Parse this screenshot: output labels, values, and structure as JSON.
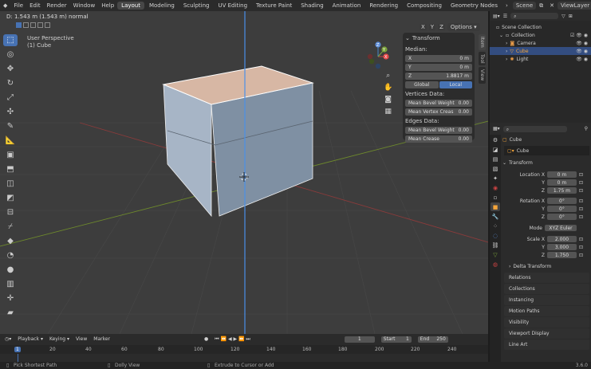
{
  "menu": {
    "items": [
      "File",
      "Edit",
      "Render",
      "Window",
      "Help"
    ]
  },
  "workspaces": [
    "Layout",
    "Modeling",
    "Sculpting",
    "UV Editing",
    "Texture Paint",
    "Shading",
    "Animation",
    "Rendering",
    "Compositing",
    "Geometry Nodes"
  ],
  "scene": "Scene",
  "view_layer": "ViewLayer",
  "viewport": {
    "op_status": "D: 1.543 m (1.543 m) normal",
    "view_name": "User Perspective",
    "object_name": "(1) Cube",
    "options_label": "Options",
    "axis_x": "X",
    "axis_y": "Y",
    "axis_z": "Z"
  },
  "npanel": {
    "title": "Transform",
    "median_label": "Median:",
    "x_label": "X",
    "x_val": "0 m",
    "y_label": "Y",
    "y_val": "0 m",
    "z_label": "Z",
    "z_val": "1.8817 m",
    "global": "Global",
    "local": "Local",
    "vertices_data": "Vertices Data:",
    "mean_bevel_weight": "Mean Bevel Weight",
    "mean_bevel_weight_val": "0.00",
    "mean_vertex_crease": "Mean Vertex Creas",
    "mean_vertex_crease_val": "0.00",
    "edges_data": "Edges Data:",
    "edge_bevel_weight": "Mean Bevel Weight",
    "edge_bevel_weight_val": "0.00",
    "mean_crease": "Mean Crease",
    "mean_crease_val": "0.00",
    "tabs": [
      "Item",
      "Tool",
      "View"
    ]
  },
  "outliner": {
    "rows": [
      {
        "name": "Scene Collection"
      },
      {
        "name": "Collection"
      },
      {
        "name": "Camera"
      },
      {
        "name": "Cube"
      },
      {
        "name": "Light"
      }
    ]
  },
  "properties": {
    "object_name": "Cube",
    "data_name": "Cube",
    "transform_title": "Transform",
    "location": {
      "label": "Location X",
      "x": "0 m",
      "y": "0 m",
      "z": "1.75 m"
    },
    "rotation": {
      "label": "Rotation X",
      "x": "0°",
      "y": "0°",
      "z": "0°"
    },
    "mode_label": "Mode",
    "mode_val": "XYZ Euler",
    "scale": {
      "label": "Scale X",
      "x": "2.000",
      "y": "3.000",
      "z": "1.750"
    },
    "y_label": "Y",
    "z_label": "Z",
    "sections": [
      "Delta Transform",
      "Relations",
      "Collections",
      "Instancing",
      "Motion Paths",
      "Visibility",
      "Viewport Display",
      "Line Art"
    ]
  },
  "timeline": {
    "playback": "Playback",
    "keying": "Keying",
    "view": "View",
    "marker": "Marker",
    "current_frame": "1",
    "start_label": "Start",
    "start": "1",
    "end_label": "End",
    "end": "250",
    "ticks": [
      "1",
      "20",
      "40",
      "60",
      "80",
      "100",
      "120",
      "140",
      "160",
      "180",
      "200",
      "220",
      "240"
    ]
  },
  "statusbar": {
    "left": "Pick Shortest Path",
    "mid": "Dolly View",
    "right": "Extrude to Cursor or Add",
    "version": "3.6.0"
  },
  "colors": {
    "accent": "#4772b3",
    "selected_orange": "#f5a53a",
    "z_axis": "#5d8dd6",
    "x_axis": "#b84b4b",
    "y_axis": "#7aa23a"
  }
}
